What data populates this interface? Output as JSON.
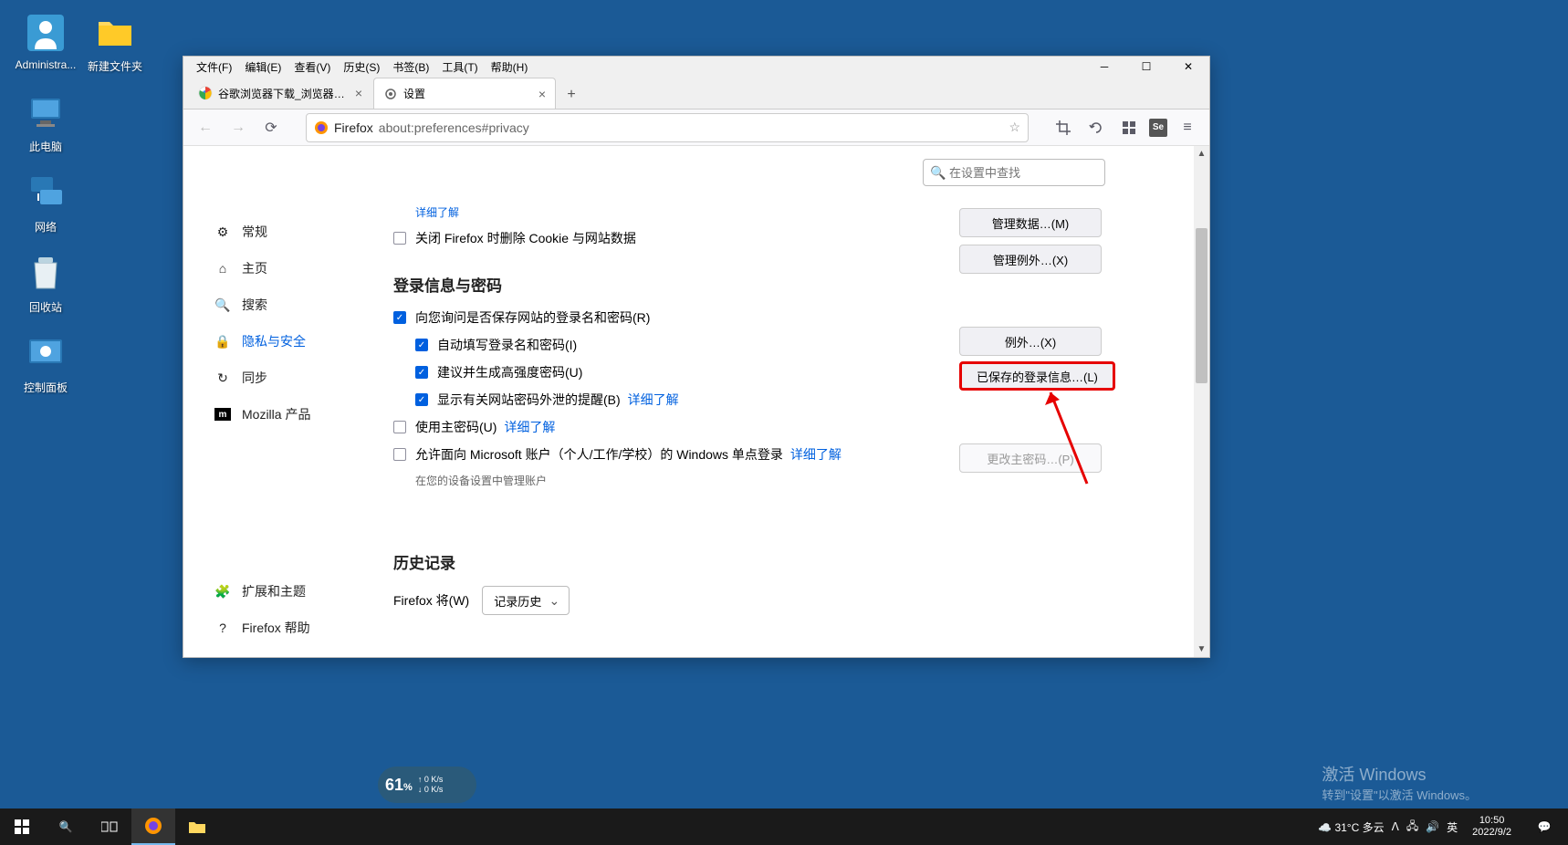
{
  "desktop": {
    "icons": [
      {
        "label": "Administra...",
        "name": "user-admin"
      },
      {
        "label": "新建文件夹",
        "name": "folder"
      },
      {
        "label": "此电脑",
        "name": "this-pc"
      },
      {
        "label": "网络",
        "name": "network"
      },
      {
        "label": "回收站",
        "name": "recycle-bin"
      },
      {
        "label": "控制面板",
        "name": "control-panel"
      }
    ]
  },
  "menubar": {
    "items": [
      "文件(F)",
      "编辑(E)",
      "查看(V)",
      "历史(S)",
      "书签(B)",
      "工具(T)",
      "帮助(H)"
    ]
  },
  "tabs": {
    "t0": {
      "label": "谷歌浏览器下载_浏览器官网入口"
    },
    "t1": {
      "label": "设置"
    }
  },
  "urlbar": {
    "prefix": "Firefox",
    "url": "about:preferences#privacy"
  },
  "search": {
    "placeholder": "在设置中查找"
  },
  "sidebar": {
    "general": "常规",
    "home": "主页",
    "search": "搜索",
    "privacy": "隐私与安全",
    "sync": "同步",
    "mozilla": "Mozilla 产品",
    "extensions": "扩展和主题",
    "help": "Firefox 帮助"
  },
  "content": {
    "partial_link": "详细了解",
    "cookie_clear": "关闭 Firefox 时删除 Cookie 与网站数据",
    "manage_data": "管理数据…(M)",
    "manage_exceptions": "管理例外…(X)",
    "logins_heading": "登录信息与密码",
    "ask_save": "向您询问是否保存网站的登录名和密码(R)",
    "autofill": "自动填写登录名和密码(I)",
    "suggest_strong": "建议并生成高强度密码(U)",
    "breach_alerts": "显示有关网站密码外泄的提醒(B)",
    "learn_more": "详细了解",
    "use_master": "使用主密码(U)",
    "learn_more2": "详细了解",
    "ms_sso": "允许面向 Microsoft 账户（个人/工作/学校）的 Windows 单点登录",
    "learn_more3": "详细了解",
    "device_sub": "在您的设备设置中管理账户",
    "exceptions_btn": "例外…(X)",
    "saved_logins_btn": "已保存的登录信息…(L)",
    "change_master_btn": "更改主密码…(P)",
    "history_heading": "历史记录",
    "history_label": "Firefox 将(W)",
    "history_value": "记录历史"
  },
  "watermark": {
    "line1": "激活 Windows",
    "line2": "转到\"设置\"以激活 Windows。"
  },
  "netmeter": {
    "pct": "61",
    "up": "0 K/s",
    "down": "0 K/s"
  },
  "taskbar": {
    "weather": "31°C 多云",
    "ime": "英",
    "time": "10:50",
    "date": "2022/9/2"
  }
}
